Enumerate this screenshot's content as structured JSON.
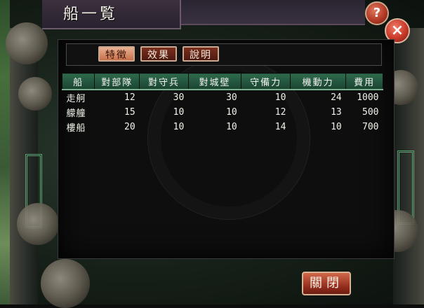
{
  "window": {
    "title": "船一覧"
  },
  "controls": {
    "help_label": "?",
    "close_label": "×",
    "close_button_label": "關閉"
  },
  "tabs": [
    {
      "label": "特徵",
      "active": true
    },
    {
      "label": "效果",
      "active": false
    },
    {
      "label": "說明",
      "active": false
    }
  ],
  "table": {
    "headers": [
      "船",
      "對部隊",
      "對守兵",
      "對城壁",
      "守備力",
      "機動力",
      "費用"
    ],
    "rows": [
      [
        "走舸",
        "12",
        "30",
        "30",
        "10",
        "24",
        "1000"
      ],
      [
        "艨艟",
        "15",
        "10",
        "10",
        "12",
        "13",
        "500"
      ],
      [
        "樓船",
        "20",
        "10",
        "10",
        "14",
        "10",
        "700"
      ]
    ]
  },
  "colors": {
    "header_green": "#2e6a4c",
    "tab_active": "#c8704c",
    "tab_inactive": "#4e1a10",
    "button_red": "#8e2a1a"
  }
}
